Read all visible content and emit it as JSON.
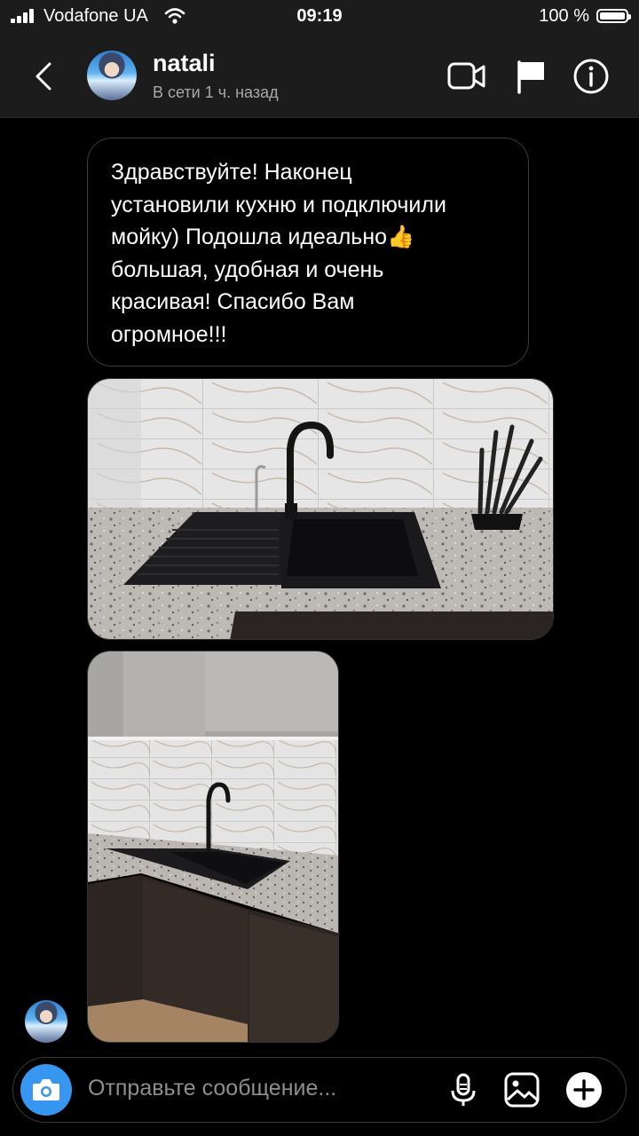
{
  "status_bar": {
    "carrier": "Vodafone UA",
    "time": "09:19",
    "battery": "100 %"
  },
  "header": {
    "contact_name": "natali",
    "presence": "В сети 1 ч. назад",
    "icons": [
      "back-icon",
      "video-call-icon",
      "flag-icon",
      "info-icon"
    ]
  },
  "messages": [
    {
      "type": "text",
      "lines": [
        "Здравствуйте!  Наконец",
        "установили кухню и подключили",
        "мойку) Подошла идеально👍",
        "большая, удобная и очень",
        "красивая! Спасибо Вам",
        "огромное!!!"
      ]
    },
    {
      "type": "photo",
      "subject": "kitchen-sink-photo"
    },
    {
      "type": "photo",
      "subject": "kitchen-corner-photo"
    }
  ],
  "composer": {
    "placeholder": "Отправьте сообщение...",
    "icons": [
      "camera-icon",
      "microphone-icon",
      "gallery-icon",
      "plus-icon"
    ]
  },
  "colors": {
    "background": "#000000",
    "header": "#1c1c1c",
    "accent_camera": "#3797f0",
    "secondary_text": "#a8a8a8"
  }
}
